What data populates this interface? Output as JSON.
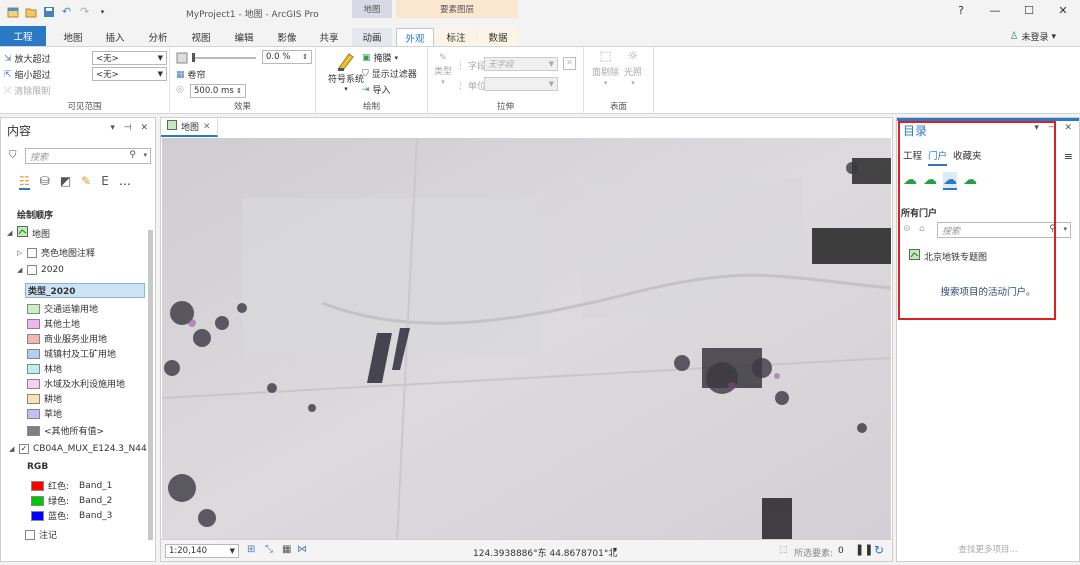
{
  "titlebar": {
    "window_title": "MyProject1 - 地图 - ArcGIS Pro",
    "ctx_map": "地图",
    "ctx_feature_layer": "要素图层",
    "help": "?",
    "minimize": "—",
    "maximize": "☐",
    "close": "✕"
  },
  "tabs": {
    "project": "工程",
    "items": [
      "地图",
      "插入",
      "分析",
      "视图",
      "编辑",
      "影像",
      "共享",
      "动画",
      "外观",
      "标注",
      "数据"
    ],
    "active": "外观"
  },
  "user": {
    "label": "未登录",
    "arrow": "▾"
  },
  "ribbon": {
    "visible_range": {
      "zoom_in_beyond": "放大超过",
      "zoom_out_beyond": "缩小超过",
      "clear_limits": "清除限制",
      "zoom_in_value": "<无>",
      "zoom_out_value": "<无>",
      "label": "可见范围"
    },
    "effects": {
      "transparency_value": "0.0",
      "transparency_unit": "%",
      "swipe": "卷帘",
      "flicker_value": "500.0",
      "flicker_unit": "ms",
      "label": "效果"
    },
    "drawing": {
      "symbology": "符号系统",
      "mask": "掩膜",
      "display_filter": "显示过滤器",
      "import": "导入",
      "label": "绘制"
    },
    "extrusion": {
      "type": "类型",
      "field": "字段",
      "field_value": "无字段",
      "unit": "单位",
      "label": "拉伸"
    },
    "faces": {
      "backface_culling": "面剔除",
      "lighting": "光照",
      "label": "表面"
    }
  },
  "contents": {
    "title": "内容",
    "search_placeholder": "搜索",
    "drawing_order": "绘制顺序",
    "map": "地图",
    "basemap_labels": "亮色地图注释",
    "layer_2020": "2020",
    "class_field": "类型_2020",
    "classes": [
      {
        "label": "交通运输用地",
        "color": "#c8f0c0"
      },
      {
        "label": "其他土地",
        "color": "#f0b4f0"
      },
      {
        "label": "商业服务业用地",
        "color": "#f5b8b0"
      },
      {
        "label": "城镇村及工矿用地",
        "color": "#b0d0f0"
      },
      {
        "label": "林地",
        "color": "#b8f0f0"
      },
      {
        "label": "水域及水利设施用地",
        "color": "#f5d0f0"
      },
      {
        "label": "耕地",
        "color": "#fbe4b0"
      },
      {
        "label": "草地",
        "color": "#c0c0f5"
      }
    ],
    "other_values": "<其他所有值>",
    "other_color": "#808080",
    "raster_layer": "CB04A_MUX_E124.3_N44",
    "rgb": "RGB",
    "bands": [
      {
        "label": "红色:",
        "band": "Band_1",
        "color": "#ff0000"
      },
      {
        "label": "绿色:",
        "band": "Band_2",
        "color": "#00c800"
      },
      {
        "label": "蓝色:",
        "band": "Band_3",
        "color": "#0000ff"
      }
    ],
    "annotation": "注记"
  },
  "map_view": {
    "tab_label": "地图",
    "scale": "1:20,140",
    "coordinates": "124.3938886°东 44.8678701°北",
    "selected_features_label": "所选要素:",
    "selected_features_count": "0"
  },
  "catalog": {
    "title": "目录",
    "tabs": [
      "工程",
      "门户",
      "收藏夹"
    ],
    "active_tab": "门户",
    "all_portal": "所有门户",
    "search_placeholder": "搜索",
    "item": "北京地铁专题图",
    "hint": "搜索项目的活动门户。",
    "more_results": "查找更多项目..."
  },
  "colors": {
    "accent": "#2b78c5",
    "highlight_box": "#e02020"
  }
}
